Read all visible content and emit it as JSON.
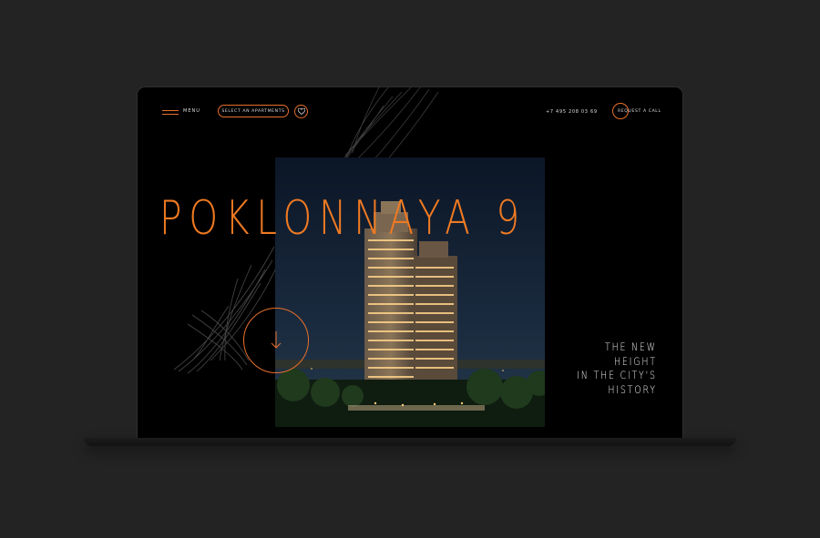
{
  "nav": {
    "menu_label": "MENU",
    "select_label": "SELECT AN APARTMENTS",
    "phone": "+7 495 208 03 69",
    "request_label": "REQUEST A CALL"
  },
  "hero": {
    "title": "POKLONNAYA 9",
    "tagline_lines": [
      "THE NEW",
      "HEIGHT",
      "IN THE CITY'S",
      "HISTORY"
    ]
  },
  "colors": {
    "accent": "#f07a22",
    "background": "#000000",
    "frame": "#232323"
  },
  "icons": {
    "favorite": "heart-icon",
    "scroll": "arrow-down-icon",
    "menu": "hamburger-icon"
  }
}
